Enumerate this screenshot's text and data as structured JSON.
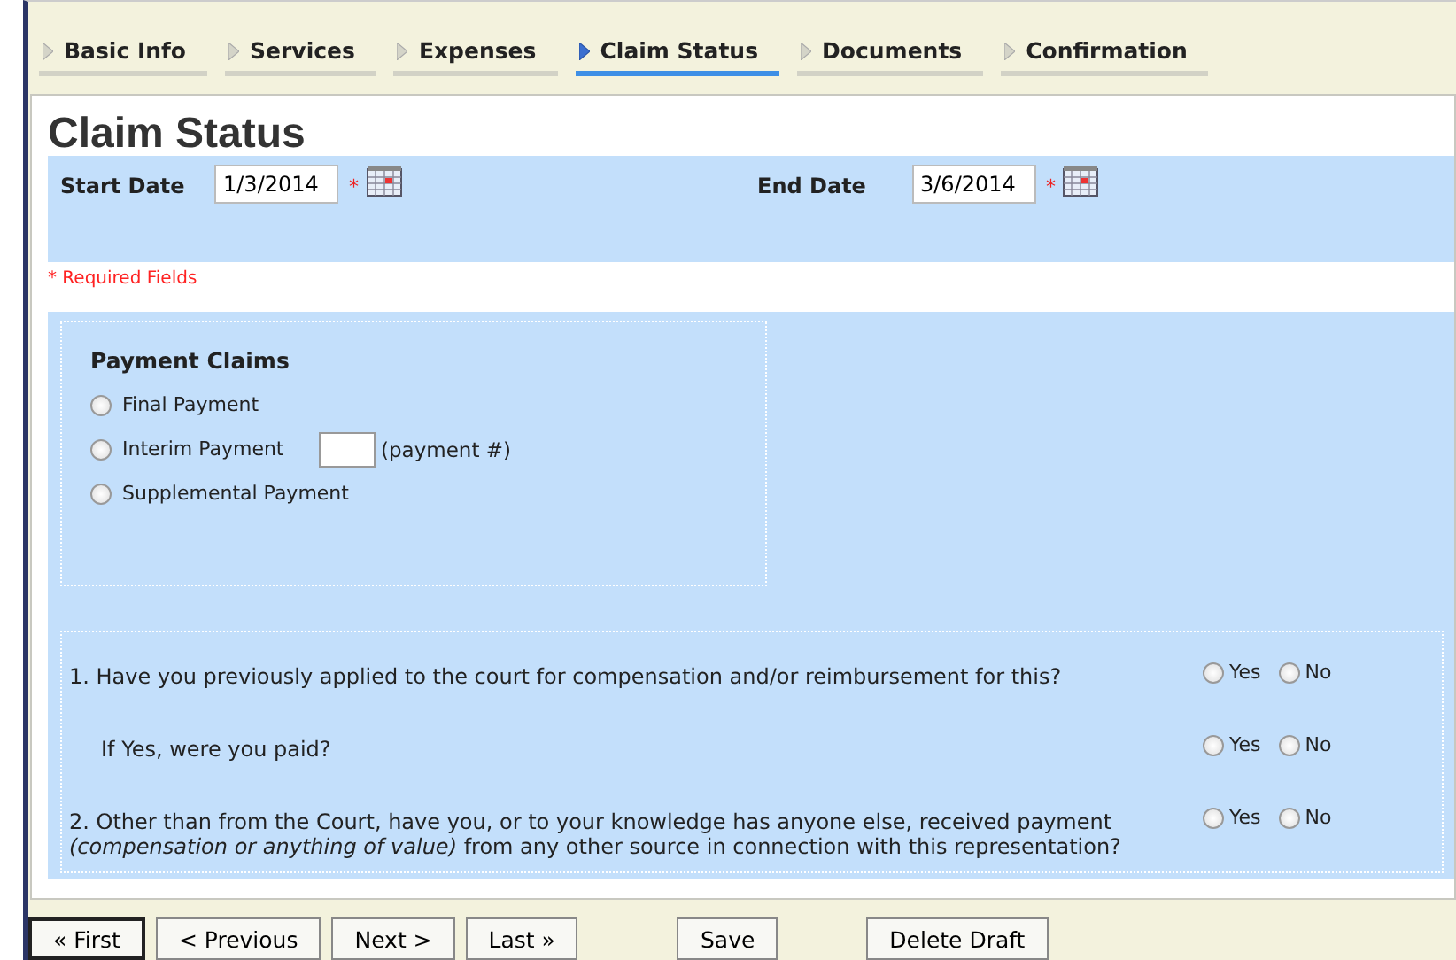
{
  "tabs": [
    {
      "label": "Basic Info",
      "selected": false
    },
    {
      "label": "Services",
      "selected": false
    },
    {
      "label": "Expenses",
      "selected": false
    },
    {
      "label": "Claim Status",
      "selected": true
    },
    {
      "label": "Documents",
      "selected": false
    },
    {
      "label": "Confirmation",
      "selected": false
    }
  ],
  "title": "Claim Status",
  "dates": [
    {
      "label": "Start Date",
      "value": "1/3/2014",
      "required_mark": "*"
    },
    {
      "label": "End Date",
      "value": "3/6/2014",
      "required_mark": "*"
    }
  ],
  "required_note": "* Required Fields",
  "payment_claims": {
    "heading": "Payment Claims",
    "options": [
      {
        "label": "Final Payment",
        "selected": false
      },
      {
        "label": "Interim Payment",
        "selected": false,
        "field_hint": "(payment #)"
      },
      {
        "label": "Supplemental Payment",
        "selected": false
      }
    ]
  },
  "questions": [
    {
      "text": "1. Have you previously applied to the court for compensation and/or reimbursement for this?",
      "indent": false,
      "options": [
        {
          "label": "Yes",
          "selected": false
        },
        {
          "label": "No",
          "selected": false
        }
      ]
    },
    {
      "text": "If Yes, were you paid?",
      "indent": true,
      "options": [
        {
          "label": "Yes",
          "selected": false
        },
        {
          "label": "No",
          "selected": false
        }
      ]
    },
    {
      "text": "2. Other than from the Court, have you, or to your knowledge has anyone else, received payment *(compensation or anything of value)* from any other source in connection with this representation?",
      "indent": false,
      "options": [
        {
          "label": "Yes",
          "selected": false
        },
        {
          "label": "No",
          "selected": false
        }
      ]
    }
  ],
  "buttons": [
    {
      "label": "« First",
      "kind": "nav"
    },
    {
      "label": "< Previous",
      "kind": "nav"
    },
    {
      "label": "Next >",
      "kind": "nav"
    },
    {
      "label": "Last »",
      "kind": "nav"
    },
    {
      "label": "Save",
      "kind": "action"
    },
    {
      "label": "Delete Draft",
      "kind": "action"
    }
  ]
}
